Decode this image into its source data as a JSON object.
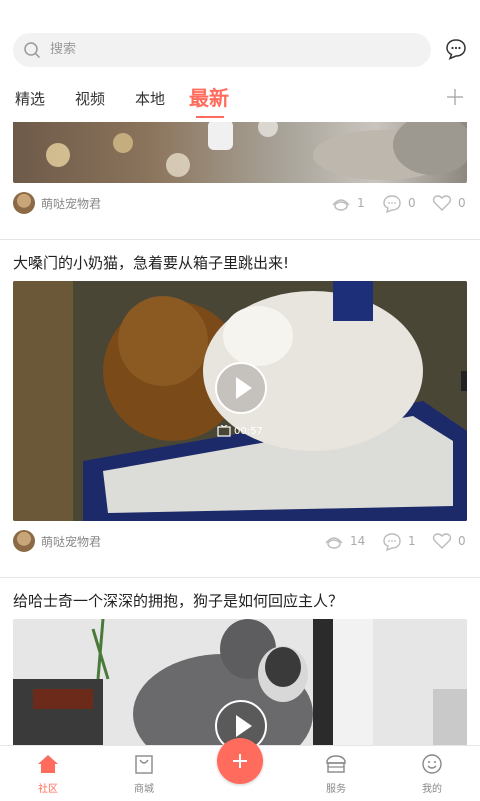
{
  "search": {
    "placeholder": "搜索"
  },
  "tabs": [
    {
      "label": "精选"
    },
    {
      "label": "视频"
    },
    {
      "label": "本地"
    },
    {
      "label": "最新"
    }
  ],
  "posts": [
    {
      "title": "",
      "author": "萌哒宠物君",
      "views": "1",
      "comments": "0",
      "likes": "0"
    },
    {
      "title": "大嗓门的小奶猫，急着要从箱子里跳出来!",
      "author": "萌哒宠物君",
      "duration": "00:57",
      "views": "14",
      "comments": "1",
      "likes": "0"
    },
    {
      "title": "给哈士奇一个深深的拥抱，狗子是如何回应主人？"
    }
  ],
  "bottom_nav": [
    {
      "label": "社区",
      "icon": "home-icon"
    },
    {
      "label": "商城",
      "icon": "shopping-bag-icon"
    },
    {
      "label": "",
      "icon": "plus-icon"
    },
    {
      "label": "服务",
      "icon": "shop-icon"
    },
    {
      "label": "我的",
      "icon": "smile-icon"
    }
  ],
  "colors": {
    "accent": "#ff6b5c"
  }
}
